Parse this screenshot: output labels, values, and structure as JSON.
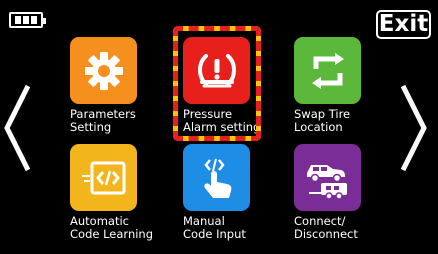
{
  "header": {
    "battery_icon": "battery-icon",
    "exit_label": "Exit"
  },
  "nav": {
    "prev_icon": "chevron-left-icon",
    "next_icon": "chevron-right-icon"
  },
  "tiles": [
    {
      "label": "Parameters\nSetting",
      "icon": "gear-icon",
      "color": "#f5901e"
    },
    {
      "label": "Pressure\nAlarm setting",
      "icon": "tire-pressure-warning-icon",
      "color": "#e8201b"
    },
    {
      "label": "Swap Tire\nLocation",
      "icon": "swap-arrows-icon",
      "color": "#5cb83a"
    },
    {
      "label": "Automatic\nCode Learning",
      "icon": "code-learning-icon",
      "color": "#f3b51c"
    },
    {
      "label": "Manual\nCode Input",
      "icon": "hand-tap-icon",
      "color": "#1e8de6"
    },
    {
      "label": "Connect/\nDisconnect",
      "icon": "car-trailer-icon",
      "color": "#7a2d97"
    }
  ],
  "selected_tile": "Pressure\nAlarm setting",
  "colors": {
    "background": "#000000",
    "selection_primary": "#f5c800",
    "selection_secondary": "#e62020"
  }
}
